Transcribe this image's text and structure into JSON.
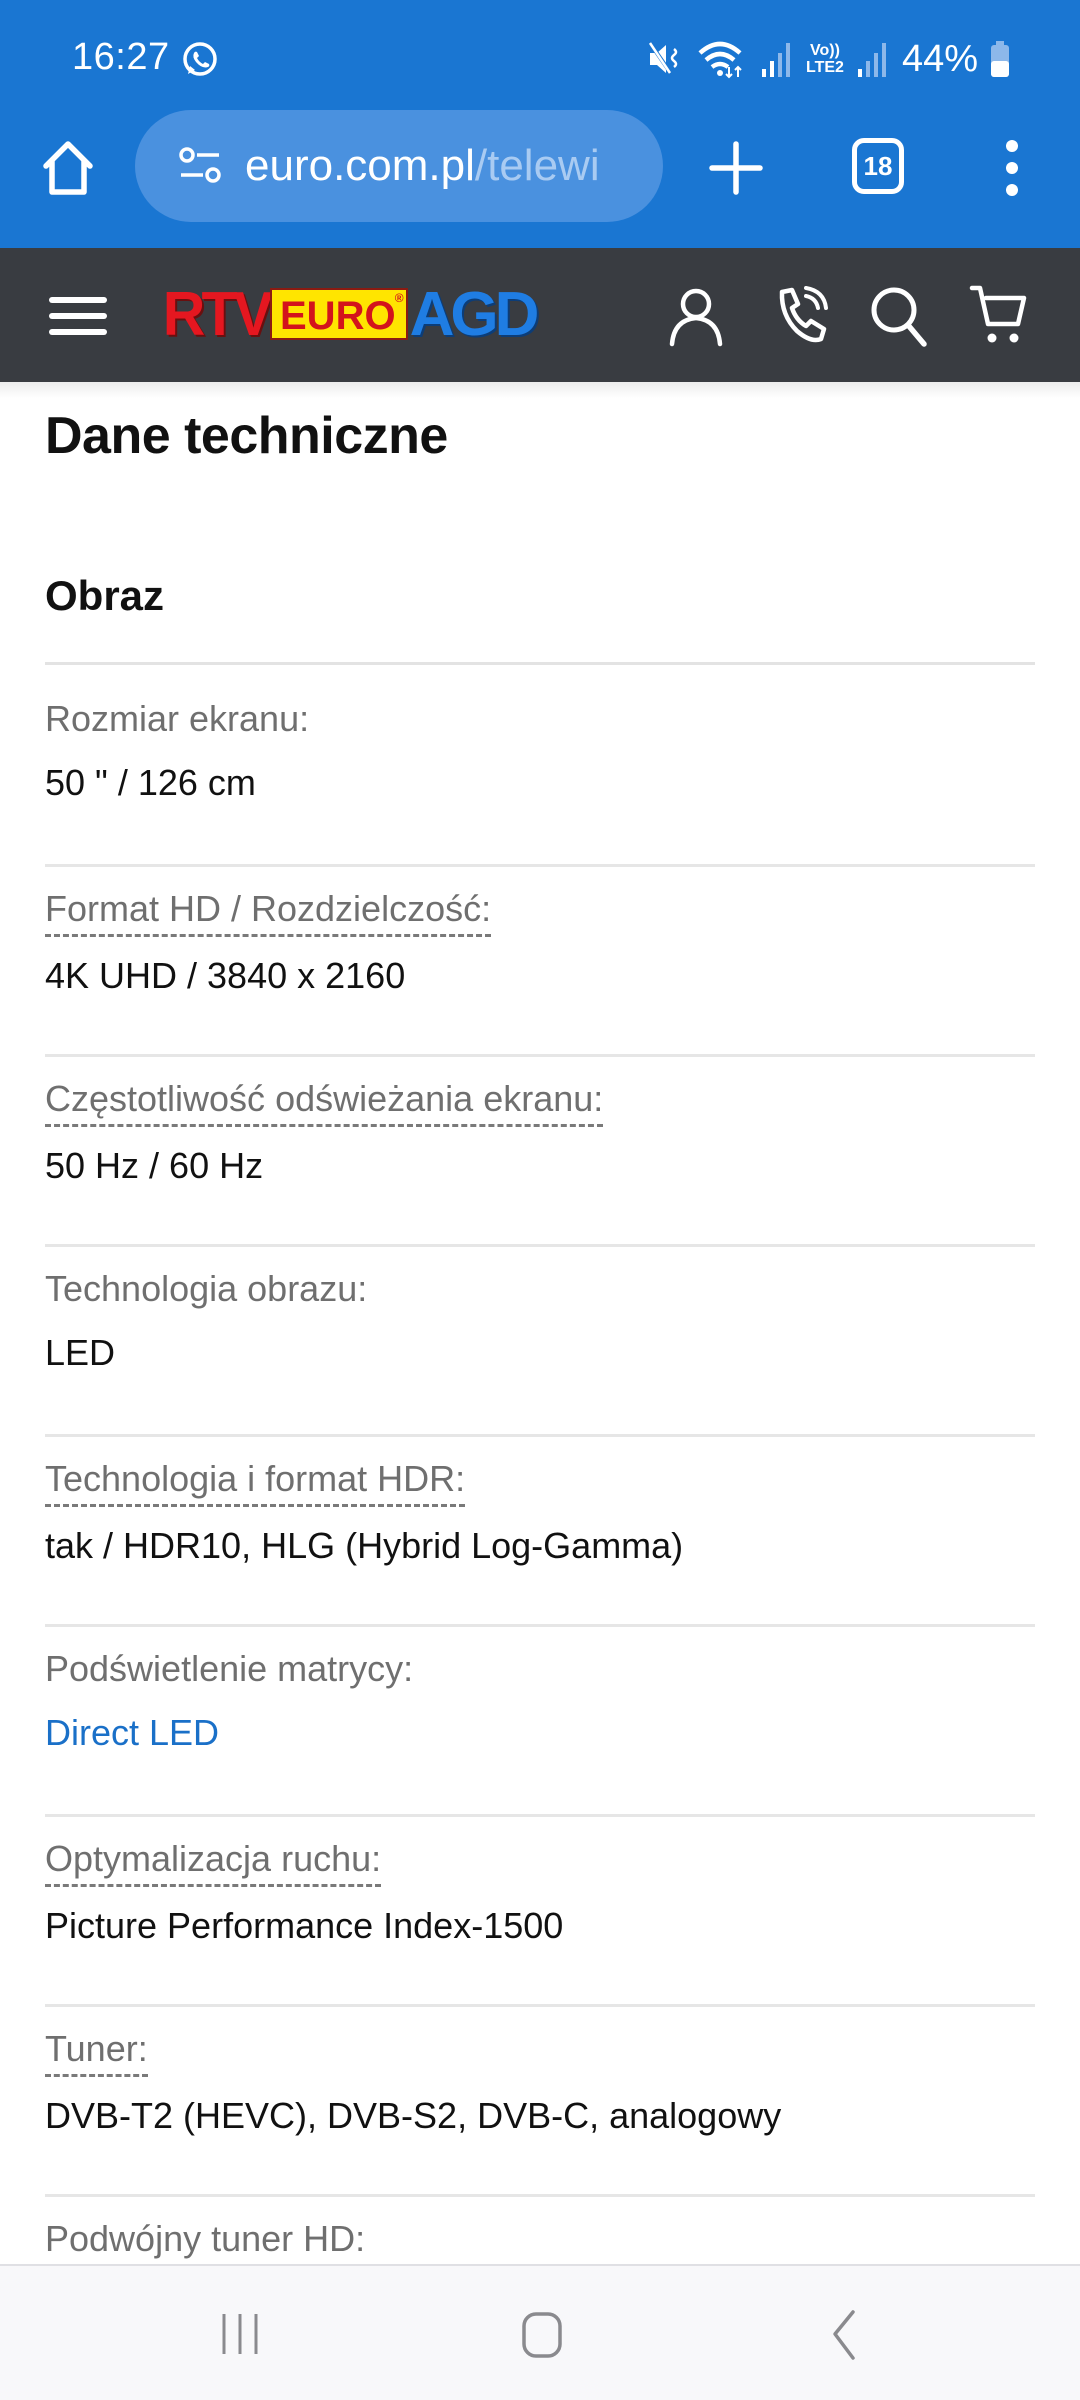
{
  "status_bar": {
    "time": "16:27",
    "battery_percent": "44%",
    "icons": [
      "whatsapp-icon",
      "mute-icon",
      "wifi-icon",
      "signal-icon",
      "volte-lte2-icon",
      "signal-icon-2",
      "battery-icon"
    ],
    "volte_label_top": "Vo))",
    "volte_label_bottom": "LTE2"
  },
  "browser": {
    "url_domain": "euro.com.pl",
    "url_path": "/telewi",
    "tab_count": "18",
    "icons": [
      "home-icon",
      "site-settings-icon",
      "new-tab-icon",
      "tabs-icon",
      "more-menu-icon"
    ]
  },
  "site_header": {
    "logo": {
      "part1": "RTV",
      "part2": "EURO",
      "registered": "®",
      "part3": "AGD"
    },
    "colors": {
      "background": "#393c41",
      "logo_red": "#e51720",
      "logo_yellow": "#ffe500",
      "logo_blue": "#1f7de3"
    },
    "icons": [
      "hamburger-menu-icon",
      "account-icon",
      "phone-icon",
      "search-icon",
      "cart-icon"
    ]
  },
  "main": {
    "page_title": "Dane techniczne",
    "section_title": "Obraz",
    "specs": [
      {
        "label": "Rozmiar ekranu:",
        "value": "50 \" / 126 cm",
        "has_tooltip": false,
        "value_is_link": false
      },
      {
        "label": "Format HD / Rozdzielczość:",
        "value": "4K UHD / 3840 x 2160",
        "has_tooltip": true,
        "value_is_link": false
      },
      {
        "label": "Częstotliwość odświeżania ekranu:",
        "value": "50 Hz / 60 Hz",
        "has_tooltip": true,
        "value_is_link": false
      },
      {
        "label": "Technologia obrazu:",
        "value": "LED",
        "has_tooltip": false,
        "value_is_link": false
      },
      {
        "label": "Technologia i format HDR:",
        "value": "tak / HDR10, HLG (Hybrid Log-Gamma)",
        "has_tooltip": true,
        "value_is_link": false
      },
      {
        "label": "Podświetlenie matrycy:",
        "value": "Direct LED",
        "has_tooltip": false,
        "value_is_link": true
      },
      {
        "label": "Optymalizacja ruchu:",
        "value": "Picture Performance Index-1500",
        "has_tooltip": true,
        "value_is_link": false
      },
      {
        "label": "Tuner:",
        "value": "DVB-T2 (HEVC), DVB-S2, DVB-C, analogowy",
        "has_tooltip": true,
        "value_is_link": false
      },
      {
        "label": "Podwójny tuner HD:",
        "value": "",
        "has_tooltip": false,
        "value_is_link": false
      }
    ],
    "link_color": "#1a70c8"
  },
  "nav_bar": {
    "buttons": [
      "recent-apps",
      "home",
      "back"
    ]
  },
  "theme": {
    "browser_blue": "#1a76d2",
    "url_box": "#4a91df"
  }
}
